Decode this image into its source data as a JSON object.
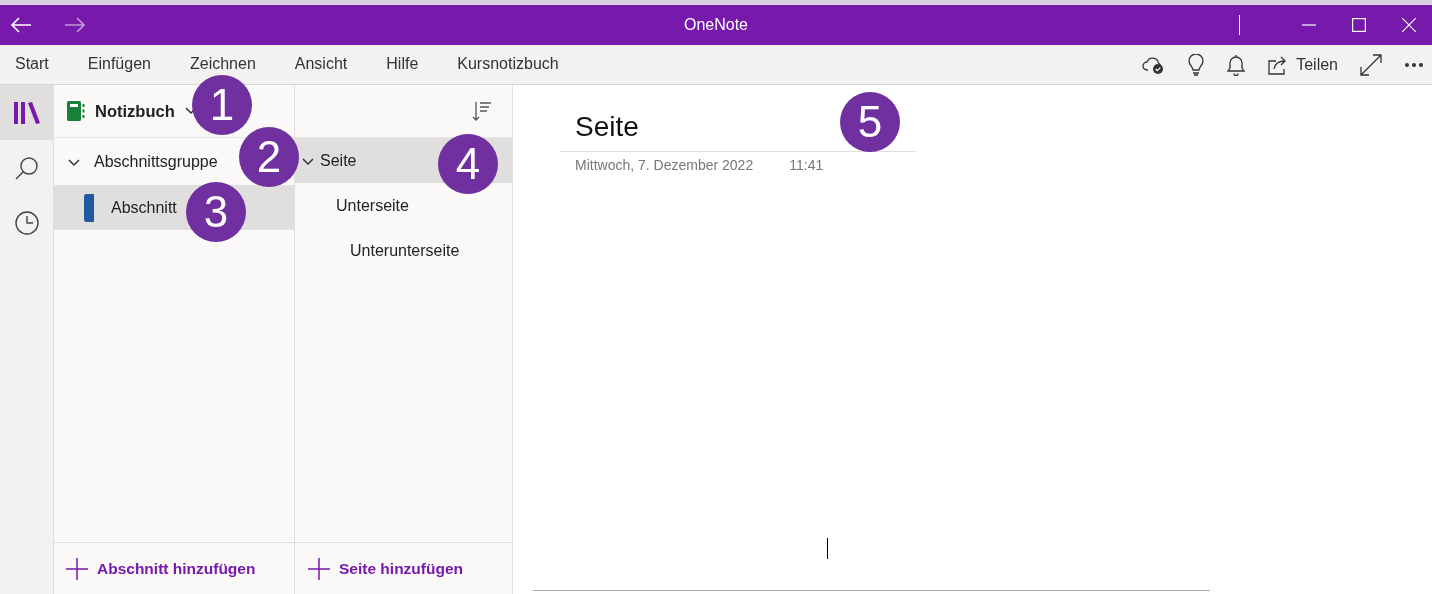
{
  "window": {
    "title": "OneNote",
    "back_enabled": true,
    "forward_enabled": false
  },
  "menu": {
    "tabs": [
      {
        "label": "Start",
        "selected": false
      },
      {
        "label": "Einfügen",
        "selected": false
      },
      {
        "label": "Zeichnen",
        "selected": false
      },
      {
        "label": "Ansicht",
        "selected": false
      },
      {
        "label": "Hilfe",
        "selected": false
      },
      {
        "label": "Kursnotizbuch",
        "selected": false
      }
    ],
    "share_label": "Teilen"
  },
  "rail": [
    {
      "kind": "notebooks",
      "selected": true
    },
    {
      "kind": "search",
      "selected": false
    },
    {
      "kind": "recent",
      "selected": false
    }
  ],
  "notebook": {
    "name": "Notizbuch"
  },
  "section_groups": [
    {
      "label": "Abschnittsgruppe",
      "expanded": true,
      "sections": [
        {
          "label": "Abschnitt",
          "selected": true,
          "color": "#1f5aa0"
        }
      ]
    }
  ],
  "pages": [
    {
      "label": "Seite",
      "expanded": true,
      "selected": true,
      "children": [
        {
          "label": "Unterseite",
          "selected": false,
          "children": [
            {
              "label": "Unterunterseite",
              "selected": false
            }
          ]
        }
      ]
    }
  ],
  "add_section": "Abschnitt hinzufügen",
  "add_page": "Seite hinzufügen",
  "page": {
    "title": "Seite",
    "date": "Mittwoch, 7. Dezember 2022",
    "time": "11:41"
  },
  "callouts": [
    "1",
    "2",
    "3",
    "4",
    "5"
  ]
}
